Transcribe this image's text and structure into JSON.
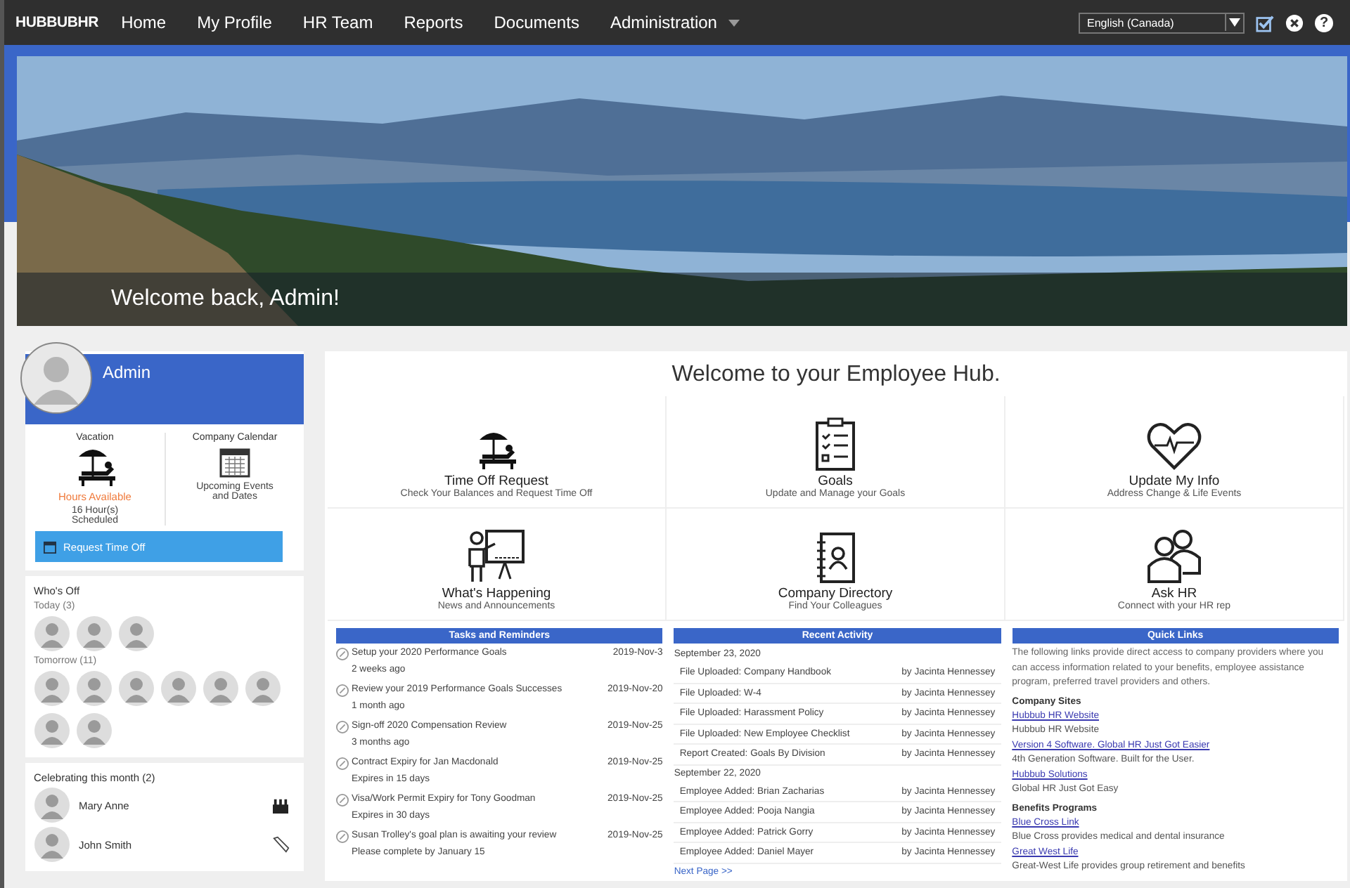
{
  "nav": {
    "logo": "HUBBUBHR",
    "items": [
      {
        "label": "Home",
        "dropdown": false
      },
      {
        "label": "My Profile",
        "dropdown": false
      },
      {
        "label": "HR Team",
        "dropdown": false
      },
      {
        "label": "Reports",
        "dropdown": false
      },
      {
        "label": "Documents",
        "dropdown": false
      },
      {
        "label": "Administration",
        "dropdown": true
      }
    ],
    "language": "English (Canada)",
    "help": "?"
  },
  "hero": {
    "greeting": "Welcome back, Admin!"
  },
  "profile": {
    "name": "Admin",
    "widgets": [
      {
        "title": "Vacation",
        "highlight": "Hours Available",
        "detail": "16 Hour(s) Scheduled"
      },
      {
        "title": "Company Calendar",
        "detail": "Upcoming Events and Dates"
      }
    ],
    "request_button": "Request Time Off"
  },
  "whos_off": {
    "title": "Who's Off",
    "today": "Today (3)",
    "tomorrow": "Tomorrow (11)"
  },
  "celebrating": {
    "title": "Celebrating this month (2)",
    "people": [
      {
        "name": "Mary Anne"
      },
      {
        "name": "John Smith"
      }
    ]
  },
  "main": {
    "title": "Welcome to your Employee Hub.",
    "tiles": [
      {
        "title": "Time Off Request",
        "subtitle": "Check Your Balances and Request Time Off"
      },
      {
        "title": "Goals",
        "subtitle": "Update and Manage your Goals"
      },
      {
        "title": "Update My Info",
        "subtitle": "Address Change & Life Events"
      },
      {
        "title": "What's Happening",
        "subtitle": "News and Announcements"
      },
      {
        "title": "Company Directory",
        "subtitle": "Find Your Colleagues"
      },
      {
        "title": "Ask HR",
        "subtitle": "Connect with your HR rep"
      }
    ]
  },
  "tasks": {
    "title": "Tasks and Reminders",
    "items": [
      {
        "task": "Setup your 2020 Performance Goals",
        "note": "2 weeks ago",
        "date": "2019-Nov-3"
      },
      {
        "task": "Review your 2019 Performance Goals Successes",
        "note": "1 month ago",
        "date": "2019-Nov-20"
      },
      {
        "task": "Sign-off 2020 Compensation Review",
        "note": "3 months ago",
        "date": "2019-Nov-25"
      },
      {
        "task": "Contract Expiry for Jan Macdonald",
        "note": "Expires in 15 days",
        "date": "2019-Nov-25"
      },
      {
        "task": "Visa/Work Permit Expiry for Tony Goodman",
        "note": "Expires in 30 days",
        "date": "2019-Nov-25"
      },
      {
        "task": "Susan Trolley's goal plan is awaiting your review",
        "note": "Please complete by January 15",
        "date": "2019-Nov-25"
      }
    ]
  },
  "activity": {
    "title": "Recent Activity",
    "groups": [
      {
        "date": "September 23, 2020",
        "entries": [
          {
            "action": "File Uploaded: Company Handbook",
            "by": "by Jacinta Hennessey"
          },
          {
            "action": "File Uploaded: W-4",
            "by": "by Jacinta Hennessey"
          },
          {
            "action": "File Uploaded: Harassment Policy",
            "by": "by Jacinta Hennessey"
          },
          {
            "action": "File Uploaded: New Employee Checklist",
            "by": "by Jacinta Hennessey"
          },
          {
            "action": "Report Created: Goals By Division",
            "by": "by Jacinta Hennessey"
          }
        ]
      },
      {
        "date": "September 22, 2020",
        "entries": [
          {
            "action": "Employee Added: Brian Zacharias",
            "by": "by Jacinta Hennessey"
          },
          {
            "action": "Employee Added: Pooja Nangia",
            "by": "by Jacinta Hennessey"
          },
          {
            "action": "Employee Added: Patrick Gorry",
            "by": "by Jacinta Hennessey"
          },
          {
            "action": "Employee Added: Daniel Mayer",
            "by": "by Jacinta Hennessey"
          }
        ]
      }
    ],
    "next": "Next Page >>"
  },
  "quick_links": {
    "title": "Quick Links",
    "intro": "The following links provide direct access to company providers where you can access information related to your benefits, employee assistance program, preferred travel providers and others.",
    "sections": [
      {
        "heading": "Company Sites",
        "links": [
          {
            "link": "Hubbub HR Website",
            "description": "Hubbub HR Website"
          },
          {
            "link": "Version 4 Software. Global HR Just Got Easier",
            "description": "4th Generation Software. Built for the User."
          },
          {
            "link": "Hubbub Solutions",
            "description": "Global HR Just Got Easy"
          }
        ]
      },
      {
        "heading": "Benefits Programs",
        "links": [
          {
            "link": "Blue Cross Link",
            "description": "Blue Cross provides medical and dental insurance"
          },
          {
            "link": "Great West Life",
            "description": "Great-West Life provides group retirement and benefits"
          }
        ]
      }
    ]
  }
}
